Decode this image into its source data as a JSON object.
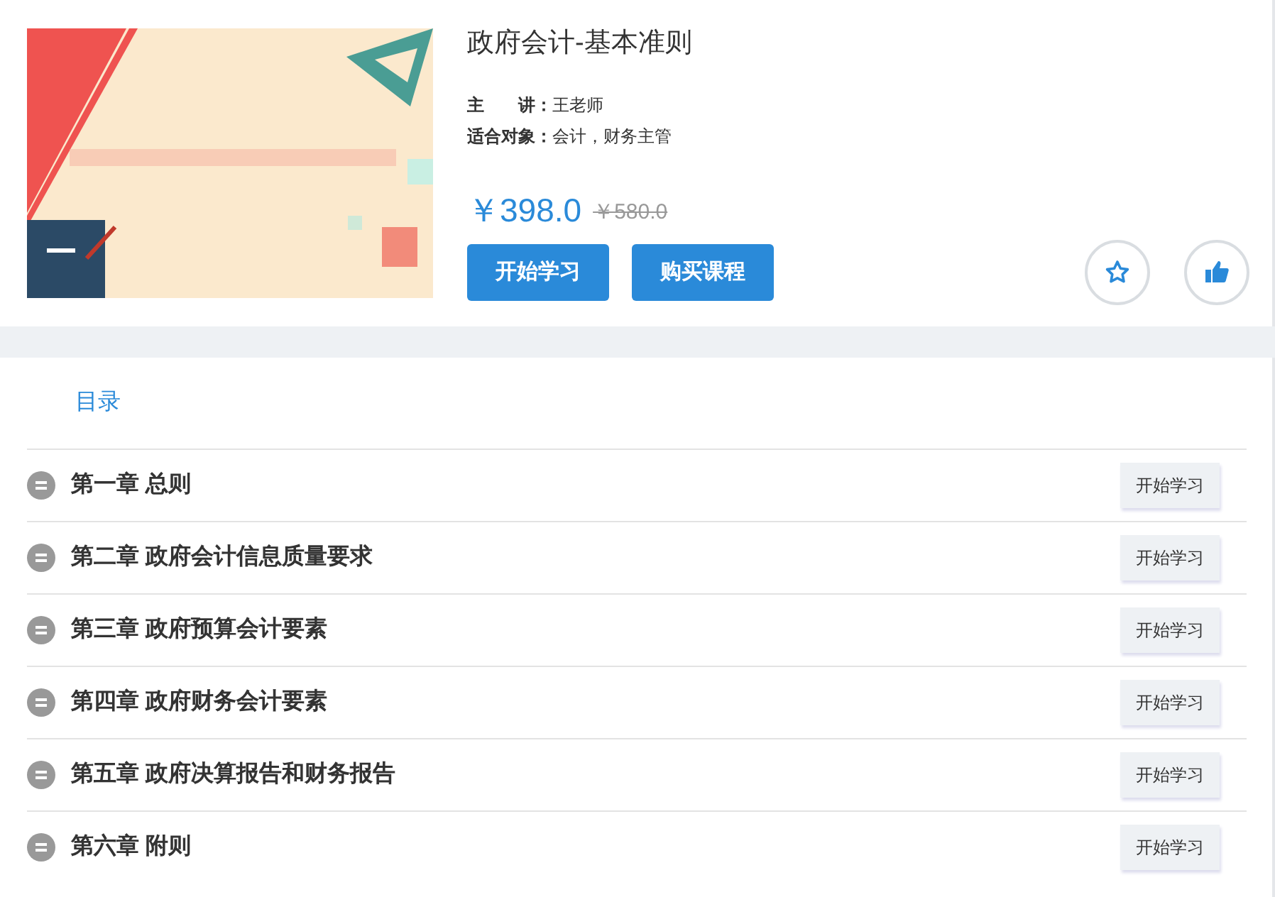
{
  "course": {
    "title": "政府会计-基本准则",
    "meta": [
      {
        "label": "主　　讲：",
        "value": "王老师"
      },
      {
        "label": "适合对象：",
        "value": "会计，财务主管"
      }
    ],
    "price": "￥398.0",
    "original_price": "￥580.0",
    "buttons": [
      "开始学习",
      "购买课程"
    ],
    "actions": [
      {
        "kind": "favorite"
      },
      {
        "kind": "like"
      }
    ]
  },
  "catalog": {
    "tab": "目录",
    "chapters": [
      {
        "title": "第一章 总则",
        "button": "开始学习"
      },
      {
        "title": "第二章 政府会计信息质量要求",
        "button": "开始学习"
      },
      {
        "title": "第三章 政府预算会计要素",
        "button": "开始学习"
      },
      {
        "title": "第四章 政府财务会计要素",
        "button": "开始学习"
      },
      {
        "title": "第五章 政府决算报告和财务报告",
        "button": "开始学习"
      },
      {
        "title": "第六章 附则",
        "button": "开始学习"
      }
    ]
  }
}
